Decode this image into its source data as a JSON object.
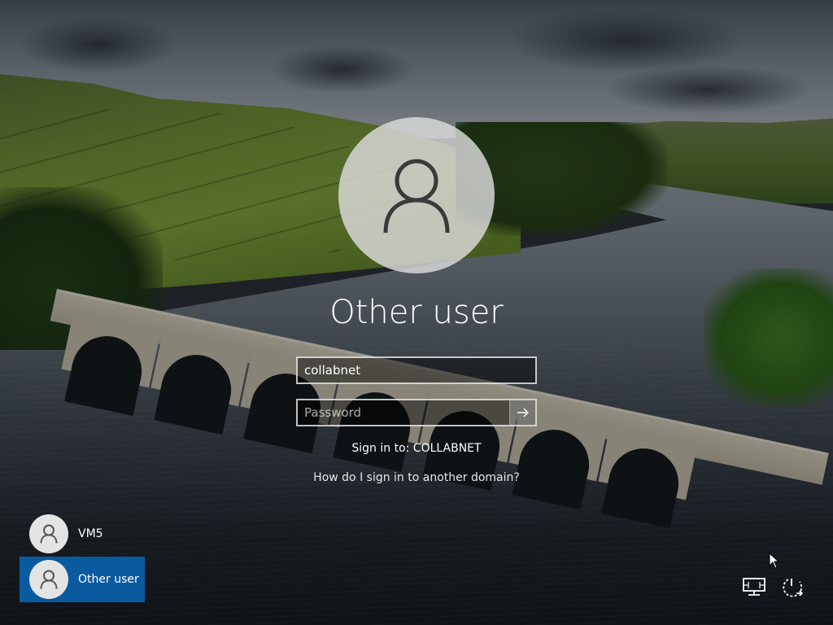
{
  "main": {
    "title": "Other user",
    "username_value": "collabnet",
    "password_placeholder": "Password",
    "sign_in_to": "Sign in to: COLLABNET",
    "domain_link": "How do I sign in to another domain?"
  },
  "users": [
    {
      "name": "VM5",
      "selected": false
    },
    {
      "name": "Other user",
      "selected": true
    }
  ],
  "icons": {
    "avatar": "user-silhouette-icon",
    "submit": "arrow-right-icon",
    "network": "network-icon",
    "power": "power-icon"
  },
  "colors": {
    "selected_tile": "#0a5aa0",
    "avatar_bg": "#dcdcdc"
  }
}
